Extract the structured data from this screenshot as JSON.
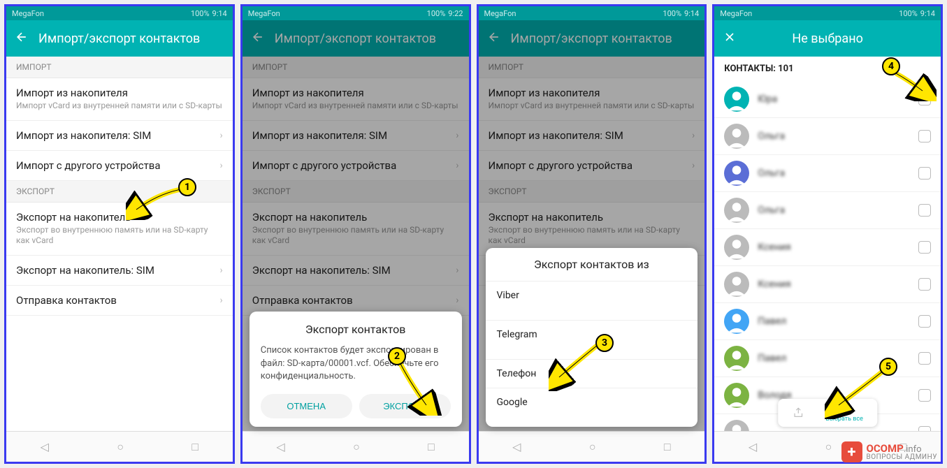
{
  "statusbar": {
    "carrier": "MegaFon",
    "battery": "100%",
    "t1": "9:14",
    "t2": "9:22",
    "t3": "9:14",
    "t4": "9:14"
  },
  "appbar": {
    "title": "Импорт/экспорт контактов",
    "title4": "Не выбрано"
  },
  "sections": {
    "import": "ИМПОРТ",
    "export": "ЭКСПОРТ"
  },
  "items": {
    "imp_storage": {
      "title": "Импорт из накопителя",
      "sub": "Импорт vCard из внутренней памяти или с SD-карты"
    },
    "imp_sim": {
      "title": "Импорт из накопителя: SIM"
    },
    "imp_other": {
      "title": "Импорт с другого устройства"
    },
    "exp_storage": {
      "title": "Экспорт на накопитель",
      "sub": "Экспорт во внутреннюю память или на SD-карту как vCard"
    },
    "exp_sim": {
      "title": "Экспорт на накопитель: SIM"
    },
    "send": {
      "title": "Отправка контактов"
    }
  },
  "dialog": {
    "title": "Экспорт контактов",
    "text": "Список контактов будет экспортирован в файл: SD-карта/00001.vcf. Обеспечьте его конфиденциальность.",
    "cancel": "ОТМЕНА",
    "export": "ЭКСПОРТ"
  },
  "sheet": {
    "title": "Экспорт контактов из",
    "viber": "Viber",
    "telegram": "Telegram",
    "phone": "Телефон",
    "google": "Google"
  },
  "screen4": {
    "header": "КОНТАКТЫ: 101",
    "contacts": [
      {
        "name": "Юра",
        "color": "#00b3b3"
      },
      {
        "name": "Ольга",
        "color": "#bbb"
      },
      {
        "name": "Ольга",
        "color": "#5b6ed6"
      },
      {
        "name": "Ольга",
        "color": "#bbb"
      },
      {
        "name": "Ксения",
        "color": "#bbb"
      },
      {
        "name": "Ксения",
        "color": "#bbb"
      },
      {
        "name": "Павел",
        "color": "#42a5f5"
      },
      {
        "name": "Павел",
        "color": "#7cb342"
      },
      {
        "name": "Володя",
        "color": "#7cb342"
      },
      {
        "name": "",
        "color": "#bbb"
      }
    ],
    "selectall": "Выбрать все"
  },
  "callouts": {
    "c1": "1",
    "c2": "2",
    "c3": "3",
    "c4": "4",
    "c5": "5"
  },
  "watermark": {
    "brand": "OCOMP",
    "tld": ".info",
    "sub": "ВОПРОСЫ АДМИНУ"
  }
}
